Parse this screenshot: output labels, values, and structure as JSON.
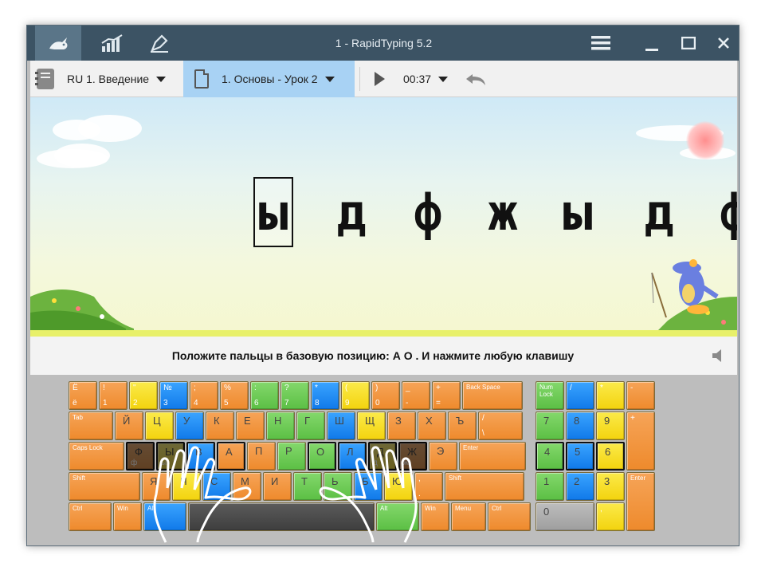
{
  "window": {
    "title": "1 - RapidTyping 5.2",
    "toolbar_icons": [
      "rabbit-icon",
      "statistics-icon",
      "editor-icon"
    ],
    "controls": [
      "menu-icon",
      "minimize-icon",
      "maximize-icon",
      "close-icon"
    ]
  },
  "toolbar": {
    "course_label": "RU 1. Введение",
    "lesson_label": "1. Основы - Урок 2",
    "timer": "00:37",
    "icons": [
      "notebook-icon",
      "document-icon",
      "play-icon",
      "undo-icon"
    ]
  },
  "exercise": {
    "letters": [
      "ы",
      "д",
      "ф",
      "ж",
      "ы",
      "д",
      "ф"
    ],
    "current_index": 0
  },
  "status": {
    "text": "Положите пальцы в базовую позицию:  А  О .  И нажмите любую клавишу"
  },
  "keyboard": {
    "rows": [
      [
        {
          "top": "Ё",
          "bot": "ё",
          "main": "",
          "color": "c-or"
        },
        {
          "top": "!",
          "bot": "1",
          "main": "",
          "color": "c-or"
        },
        {
          "top": "\"",
          "bot": "2",
          "main": "",
          "color": "c-ye"
        },
        {
          "top": "№",
          "bot": "3",
          "main": "",
          "color": "c-bl"
        },
        {
          "top": ";",
          "bot": "4",
          "main": "",
          "color": "c-or"
        },
        {
          "top": "%",
          "bot": "5",
          "main": "",
          "color": "c-or"
        },
        {
          "top": ":",
          "bot": "6",
          "main": "",
          "color": "c-gr"
        },
        {
          "top": "?",
          "bot": "7",
          "main": "",
          "color": "c-gr"
        },
        {
          "top": "*",
          "bot": "8",
          "main": "",
          "color": "c-bl"
        },
        {
          "top": "(",
          "bot": "9",
          "main": "",
          "color": "c-ye"
        },
        {
          "top": ")",
          "bot": "0",
          "main": "",
          "color": "c-or"
        },
        {
          "top": "_",
          "bot": "-",
          "main": "",
          "color": "c-or"
        },
        {
          "top": "+",
          "bot": "=",
          "main": "",
          "color": "c-or"
        },
        {
          "top": "Back Space",
          "bot": "",
          "main": "",
          "color": "c-or",
          "wide": true
        }
      ],
      [
        {
          "top": "Tab",
          "bot": "",
          "main": "",
          "color": "c-or",
          "wide": true
        },
        {
          "top": "",
          "bot": "",
          "main": "Й",
          "color": "c-or"
        },
        {
          "top": "",
          "bot": "",
          "main": "Ц",
          "color": "c-ye"
        },
        {
          "top": "",
          "bot": "",
          "main": "У",
          "color": "c-bl"
        },
        {
          "top": "",
          "bot": "",
          "main": "К",
          "color": "c-or"
        },
        {
          "top": "",
          "bot": "",
          "main": "Е",
          "color": "c-or"
        },
        {
          "top": "",
          "bot": "",
          "main": "Н",
          "color": "c-gr"
        },
        {
          "top": "",
          "bot": "",
          "main": "Г",
          "color": "c-gr"
        },
        {
          "top": "",
          "bot": "",
          "main": "Ш",
          "color": "c-bl"
        },
        {
          "top": "",
          "bot": "",
          "main": "Щ",
          "color": "c-ye"
        },
        {
          "top": "",
          "bot": "",
          "main": "З",
          "color": "c-or"
        },
        {
          "top": "",
          "bot": "",
          "main": "Х",
          "color": "c-or"
        },
        {
          "top": "",
          "bot": "",
          "main": "Ъ",
          "color": "c-or"
        },
        {
          "top": "/",
          "bot": "\\",
          "main": "",
          "color": "c-or"
        }
      ],
      [
        {
          "top": "Caps Lock",
          "bot": "",
          "main": "",
          "color": "c-or",
          "wide": true
        },
        {
          "top": "",
          "bot": "ф",
          "main": "Ф",
          "color": "c-or",
          "home": true
        },
        {
          "top": "",
          "bot": "ы",
          "main": "Ы",
          "color": "c-ye",
          "home": true
        },
        {
          "top": "",
          "bot": "",
          "main": "В",
          "color": "c-bl",
          "home": true
        },
        {
          "top": "",
          "bot": "",
          "main": "А",
          "color": "c-or",
          "home": true
        },
        {
          "top": "",
          "bot": "",
          "main": "П",
          "color": "c-or"
        },
        {
          "top": "",
          "bot": "",
          "main": "Р",
          "color": "c-gr"
        },
        {
          "top": "",
          "bot": "",
          "main": "О",
          "color": "c-gr",
          "home": true
        },
        {
          "top": "",
          "bot": "",
          "main": "Л",
          "color": "c-bl",
          "home": true
        },
        {
          "top": "",
          "bot": "д",
          "main": "Д",
          "color": "c-ye",
          "home": true
        },
        {
          "top": "",
          "bot": "ж",
          "main": "Ж",
          "color": "c-or",
          "home": true
        },
        {
          "top": "",
          "bot": "",
          "main": "Э",
          "color": "c-or"
        },
        {
          "top": "Enter",
          "bot": "",
          "main": "",
          "color": "c-or",
          "wide": true
        }
      ],
      [
        {
          "top": "Shift",
          "bot": "",
          "main": "",
          "color": "c-or",
          "wide": true
        },
        {
          "top": "",
          "bot": "",
          "main": "Я",
          "color": "c-or"
        },
        {
          "top": "",
          "bot": "",
          "main": "Ч",
          "color": "c-ye"
        },
        {
          "top": "",
          "bot": "",
          "main": "С",
          "color": "c-bl"
        },
        {
          "top": "",
          "bot": "",
          "main": "М",
          "color": "c-or"
        },
        {
          "top": "",
          "bot": "",
          "main": "И",
          "color": "c-or"
        },
        {
          "top": "",
          "bot": "",
          "main": "Т",
          "color": "c-gr"
        },
        {
          "top": "",
          "bot": "",
          "main": "Ь",
          "color": "c-gr"
        },
        {
          "top": "",
          "bot": "",
          "main": "Б",
          "color": "c-bl"
        },
        {
          "top": "",
          "bot": "",
          "main": "Ю",
          "color": "c-ye"
        },
        {
          "top": ",",
          "bot": ".",
          "main": "",
          "color": "c-or"
        },
        {
          "top": "Shift",
          "bot": "",
          "main": "",
          "color": "c-or",
          "wide": true
        }
      ],
      [
        {
          "top": "Ctrl",
          "bot": "",
          "main": "",
          "color": "c-or",
          "wide": true
        },
        {
          "top": "Win",
          "bot": "",
          "main": "",
          "color": "c-or",
          "wide": true
        },
        {
          "top": "Alt",
          "bot": "",
          "main": "",
          "color": "c-bl",
          "wide": true
        },
        {
          "top": "",
          "bot": "",
          "main": "",
          "color": "c-sp"
        },
        {
          "top": "Alt",
          "bot": "",
          "main": "",
          "color": "c-gr",
          "wide": true
        },
        {
          "top": "Win",
          "bot": "",
          "main": "",
          "color": "c-or",
          "wide": true
        },
        {
          "top": "Menu",
          "bot": "",
          "main": "",
          "color": "c-or",
          "wide": true
        },
        {
          "top": "Ctrl",
          "bot": "",
          "main": "",
          "color": "c-or",
          "wide": true
        }
      ]
    ],
    "numpad": [
      {
        "top": "Num Lock",
        "bot": "",
        "main": "",
        "color": "c-gr",
        "wide": true
      },
      {
        "top": "/",
        "bot": "",
        "main": "",
        "color": "c-bl"
      },
      {
        "top": "*",
        "bot": "",
        "main": "",
        "color": "c-ye"
      },
      {
        "top": "-",
        "bot": "",
        "main": "",
        "color": "c-or"
      },
      {
        "top": "",
        "bot": "",
        "main": "7",
        "color": "c-gr"
      },
      {
        "top": "",
        "bot": "",
        "main": "8",
        "color": "c-bl"
      },
      {
        "top": "",
        "bot": "",
        "main": "9",
        "color": "c-ye"
      },
      {
        "top": "+",
        "bot": "",
        "main": "",
        "color": "c-or"
      },
      {
        "top": "",
        "bot": "",
        "main": "4",
        "color": "c-gr",
        "home": true
      },
      {
        "top": "",
        "bot": "",
        "main": "5",
        "color": "c-bl",
        "home": true
      },
      {
        "top": "",
        "bot": "",
        "main": "6",
        "color": "c-ye",
        "home": true
      },
      {
        "top": "",
        "bot": "",
        "main": "1",
        "color": "c-gr"
      },
      {
        "top": "",
        "bot": "",
        "main": "2",
        "color": "c-bl"
      },
      {
        "top": "",
        "bot": "",
        "main": "3",
        "color": "c-ye"
      },
      {
        "top": "Enter",
        "bot": "",
        "main": "",
        "color": "c-or",
        "wide": true
      },
      {
        "top": "",
        "bot": "",
        "main": "0",
        "color": "c-gy"
      },
      {
        "top": ",",
        "bot": "",
        "main": "",
        "color": "c-ye"
      }
    ]
  }
}
